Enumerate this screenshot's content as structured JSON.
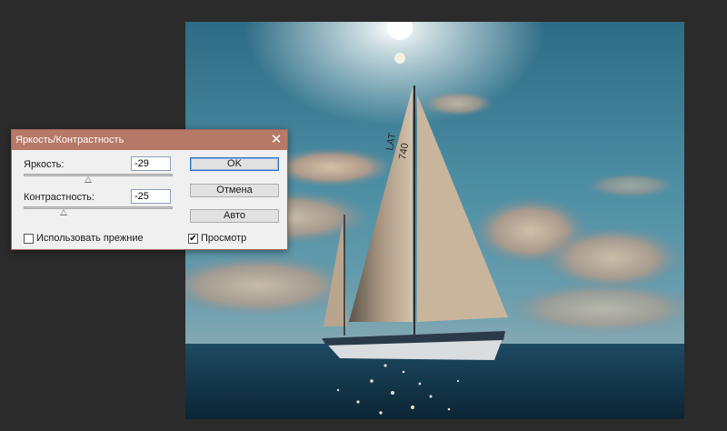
{
  "dialog": {
    "title": "Яркость/Контрастность",
    "brightness": {
      "label": "Яркость:",
      "value": "-29",
      "level": 0.43
    },
    "contrast": {
      "label": "Контрастность:",
      "value": "-25",
      "level": 0.27
    },
    "buttons": {
      "ok": "OK",
      "cancel": "Отмена",
      "auto": "Авто"
    },
    "use_legacy": {
      "label": "Использовать прежние",
      "checked": false
    },
    "preview": {
      "label": "Просмотр",
      "checked": true
    }
  },
  "photo": {
    "sail_numbers": [
      "LAT",
      "740"
    ]
  },
  "colors": {
    "workspace_bg": "#2b2b2b",
    "titlebar": "#b67867",
    "dialog_bg": "#f0f0f0",
    "sky": "#2f6f86",
    "sea": "#12354a"
  }
}
